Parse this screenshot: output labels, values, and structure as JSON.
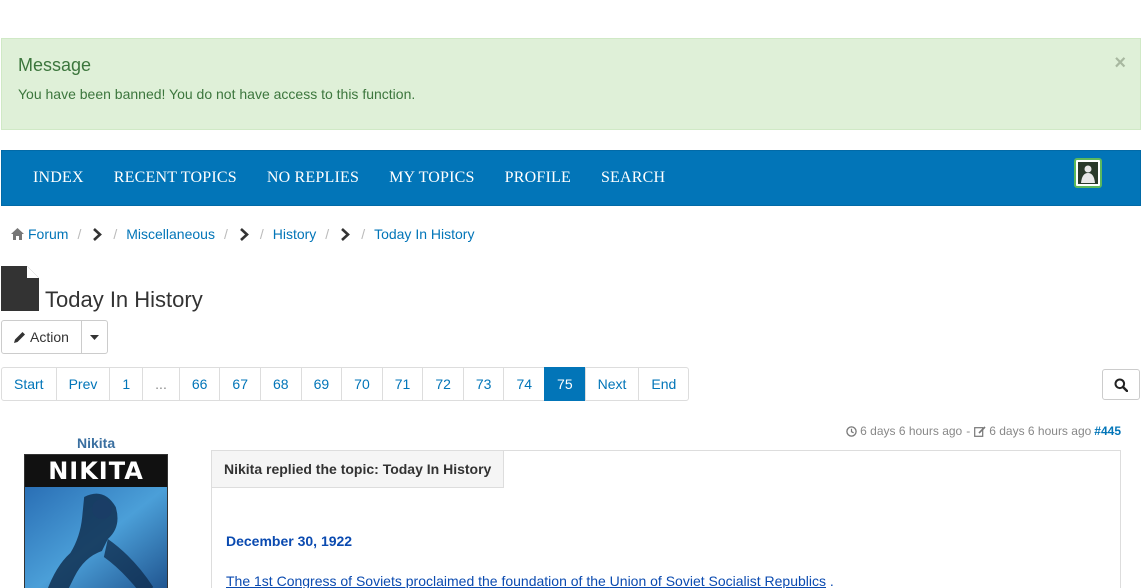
{
  "alert": {
    "title": "Message",
    "text": "You have been banned! You do not have access to this function.",
    "close_label": "×"
  },
  "nav": {
    "items": [
      "INDEX",
      "RECENT TOPICS",
      "NO REPLIES",
      "MY TOPICS",
      "PROFILE",
      "SEARCH"
    ],
    "accent": "#0275b8"
  },
  "breadcrumb": {
    "home": "Forum",
    "sep": "/",
    "c1": "Miscellaneous",
    "c2": "History",
    "c3": "Today In History"
  },
  "page": {
    "title": "Today In History"
  },
  "actions": {
    "label": "Action"
  },
  "pagination": {
    "start": "Start",
    "prev": "Prev",
    "pages": [
      "1",
      "...",
      "66",
      "67",
      "68",
      "69",
      "70",
      "71",
      "72",
      "73",
      "74",
      "75"
    ],
    "active": "75",
    "next": "Next",
    "end": "End"
  },
  "post": {
    "author": "Nikita",
    "avatar_text": "NIKITA",
    "created": "6 days 6 hours ago",
    "meta_sep": "-",
    "edited": "6 days 6 hours ago",
    "number": "#445",
    "header": "Nikita replied the topic: Today In History",
    "date": "December 30, 1922",
    "line_prefix": "The 1st Congress of Soviets proclaimed the foundation of the ",
    "line_link": "Union of Soviet Socialist Republics",
    "line_suffix": " ."
  }
}
